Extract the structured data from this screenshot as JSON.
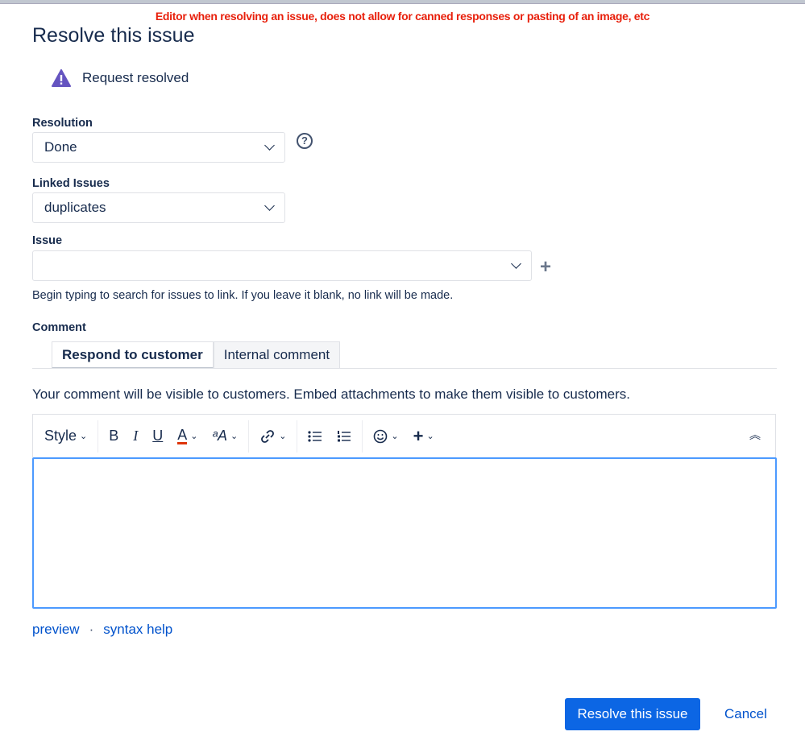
{
  "annotation": "Editor when resolving an issue, does not allow for canned responses or pasting of an image, etc",
  "title": "Resolve this issue",
  "status": {
    "text": "Request resolved",
    "icon": "warning-triangle-icon",
    "color": "#6554c0"
  },
  "resolution": {
    "label": "Resolution",
    "value": "Done"
  },
  "linked": {
    "label": "Linked Issues",
    "value": "duplicates"
  },
  "issue": {
    "label": "Issue",
    "value": "",
    "hint": "Begin typing to search for issues to link. If you leave it blank, no link will be made."
  },
  "comment": {
    "label": "Comment",
    "tabs": [
      "Respond to customer",
      "Internal comment"
    ],
    "visibility": "Your comment will be visible to customers. Embed attachments to make them visible to customers."
  },
  "toolbar": {
    "style": "Style",
    "bold": "B",
    "italic": "I",
    "underline": "U",
    "color": "A",
    "textfx": "ᵃA"
  },
  "footer": {
    "preview": "preview",
    "syntax": "syntax help",
    "submit": "Resolve this issue",
    "cancel": "Cancel"
  }
}
